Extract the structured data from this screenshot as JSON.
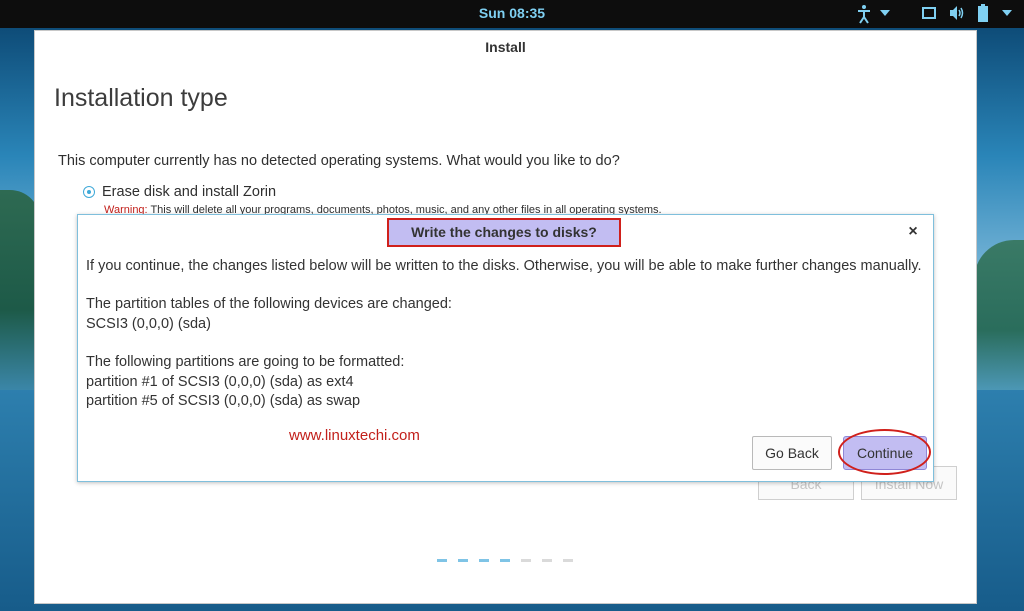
{
  "topbar": {
    "clock": "Sun 08:35",
    "icons": [
      "accessibility-icon",
      "chevron-down-icon",
      "window-icon",
      "volume-icon",
      "battery-icon",
      "chevron-down-icon"
    ]
  },
  "window": {
    "title": "Install",
    "heading": "Installation type",
    "question": "This computer currently has no detected operating systems. What would you like to do?",
    "option_label": "Erase disk and install Zorin",
    "warning_key": "Warning:",
    "warning_text": " This will delete all your programs, documents, photos, music, and any other files in all operating systems.",
    "back_label": "Back",
    "install_label": "Install Now",
    "progress_colors": [
      "#7fc4e6",
      "#7fc4e6",
      "#7fc4e6",
      "#7fc4e6",
      "#dadada",
      "#dadada",
      "#dadada"
    ]
  },
  "dialog": {
    "title": "Write the changes to disks?",
    "close": "×",
    "intro": "If you continue, the changes listed below will be written to the disks. Otherwise, you will be able to make further changes manually.",
    "partition_tables_heading": "The partition tables of the following devices are changed:",
    "device": " SCSI3 (0,0,0) (sda)",
    "format_heading": "The following partitions are going to be formatted:",
    "partitions": [
      " partition #1 of SCSI3 (0,0,0) (sda) as ext4",
      " partition #5 of SCSI3 (0,0,0) (sda) as swap"
    ],
    "watermark": "www.linuxtechi.com",
    "go_back_label": "Go Back",
    "continue_label": "Continue"
  },
  "colors": {
    "accent": "#3fa9d8",
    "highlight": "#d0201b",
    "dialog_title_bg": "#c2bdf2"
  }
}
